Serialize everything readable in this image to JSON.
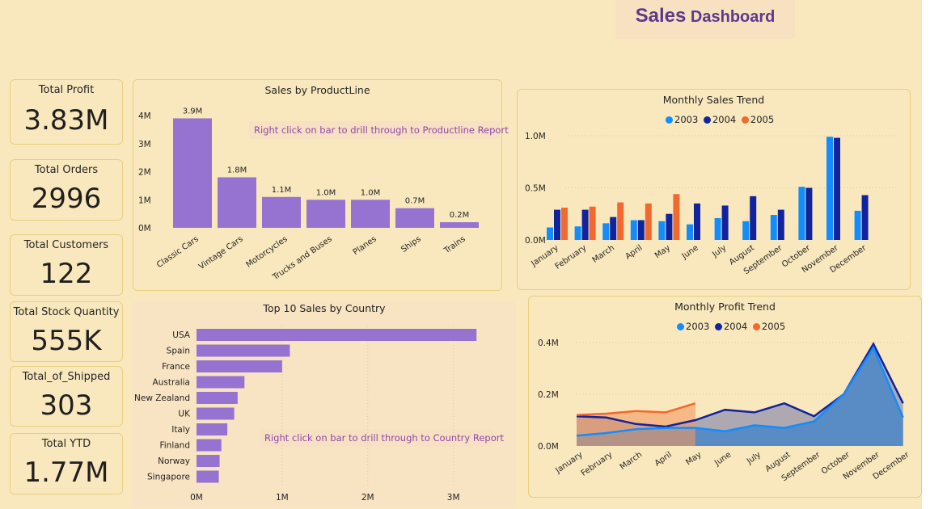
{
  "dashboard_title": {
    "part1": "Sales",
    "part2": "Dashboard"
  },
  "kpis": [
    {
      "label": "Total Profit",
      "value": "3.83M"
    },
    {
      "label": "Total Orders",
      "value": "2996"
    },
    {
      "label": "Total Customers",
      "value": "122"
    },
    {
      "label": "Total Stock Quantity",
      "value": "555K"
    },
    {
      "label": "Total_of_Shipped",
      "value": "303"
    },
    {
      "label": "Total YTD",
      "value": "1.77M"
    }
  ],
  "productline_chart": {
    "title": "Sales by ProductLine",
    "note": "Right click on bar to drill through to Productline Report"
  },
  "country_chart": {
    "title": "Top 10 Sales by Country",
    "note": "Right click on bar to drill through to Country Report"
  },
  "monthly_sales_chart": {
    "title": "Monthly Sales Trend"
  },
  "monthly_profit_chart": {
    "title": "Monthly Profit Trend"
  },
  "legend": [
    "2003",
    "2004",
    "2005"
  ],
  "colors": {
    "bar_purple": "#9673d0",
    "y2003": "#118dff",
    "y2004": "#12239e",
    "y2005": "#f2682f",
    "title_purple": "#5b3a8c"
  },
  "chart_data": [
    {
      "type": "bar",
      "title": "Sales by ProductLine",
      "categories": [
        "Classic Cars",
        "Vintage Cars",
        "Motorcycles",
        "Trucks and Buses",
        "Planes",
        "Ships",
        "Trains"
      ],
      "values": [
        3.9,
        1.8,
        1.1,
        1.0,
        1.0,
        0.7,
        0.2
      ],
      "data_labels": [
        "3.9M",
        "1.8M",
        "1.1M",
        "1.0M",
        "1.0M",
        "0.7M",
        "0.2M"
      ],
      "yticks": [
        "0M",
        "1M",
        "2M",
        "3M",
        "4M"
      ],
      "ylim": [
        0,
        4
      ]
    },
    {
      "type": "bar",
      "title": "Top 10 Sales by Country",
      "categories": [
        "USA",
        "Spain",
        "France",
        "Australia",
        "New Zealand",
        "UK",
        "Italy",
        "Finland",
        "Norway",
        "Singapore"
      ],
      "values": [
        3.27,
        1.09,
        1.0,
        0.56,
        0.48,
        0.44,
        0.36,
        0.29,
        0.27,
        0.26
      ],
      "xticks": [
        "0M",
        "1M",
        "2M",
        "3M"
      ],
      "xlim": [
        0,
        3.4
      ]
    },
    {
      "type": "bar",
      "title": "Monthly Sales Trend",
      "categories": [
        "January",
        "February",
        "March",
        "April",
        "May",
        "June",
        "July",
        "August",
        "September",
        "October",
        "November",
        "December"
      ],
      "yticks": [
        "0.0M",
        "0.5M",
        "1.0M"
      ],
      "ylim": [
        0,
        1.0
      ],
      "series": [
        {
          "name": "2003",
          "values": [
            0.12,
            0.13,
            0.16,
            0.19,
            0.18,
            0.15,
            0.21,
            0.18,
            0.24,
            0.51,
            0.99,
            0.28
          ]
        },
        {
          "name": "2004",
          "values": [
            0.29,
            0.29,
            0.22,
            0.19,
            0.25,
            0.35,
            0.33,
            0.42,
            0.29,
            0.5,
            0.98,
            0.43
          ]
        },
        {
          "name": "2005",
          "values": [
            0.31,
            0.32,
            0.36,
            0.35,
            0.44,
            null,
            null,
            null,
            null,
            null,
            null,
            null
          ]
        }
      ]
    },
    {
      "type": "area",
      "title": "Monthly Profit Trend",
      "categories": [
        "January",
        "February",
        "March",
        "April",
        "May",
        "June",
        "July",
        "August",
        "September",
        "October",
        "November",
        "December"
      ],
      "yticks": [
        "0.0M",
        "0.2M",
        "0.4M"
      ],
      "ylim": [
        0,
        0.4
      ],
      "series": [
        {
          "name": "2003",
          "values": [
            0.04,
            0.05,
            0.065,
            0.07,
            0.07,
            0.057,
            0.08,
            0.07,
            0.095,
            0.2,
            0.38,
            0.11
          ]
        },
        {
          "name": "2004",
          "values": [
            0.115,
            0.11,
            0.085,
            0.075,
            0.1,
            0.14,
            0.13,
            0.165,
            0.115,
            0.2,
            0.395,
            0.165
          ]
        },
        {
          "name": "2005",
          "values": [
            0.12,
            0.125,
            0.135,
            0.13,
            0.165,
            null,
            null,
            null,
            null,
            null,
            null,
            null
          ]
        }
      ]
    }
  ]
}
